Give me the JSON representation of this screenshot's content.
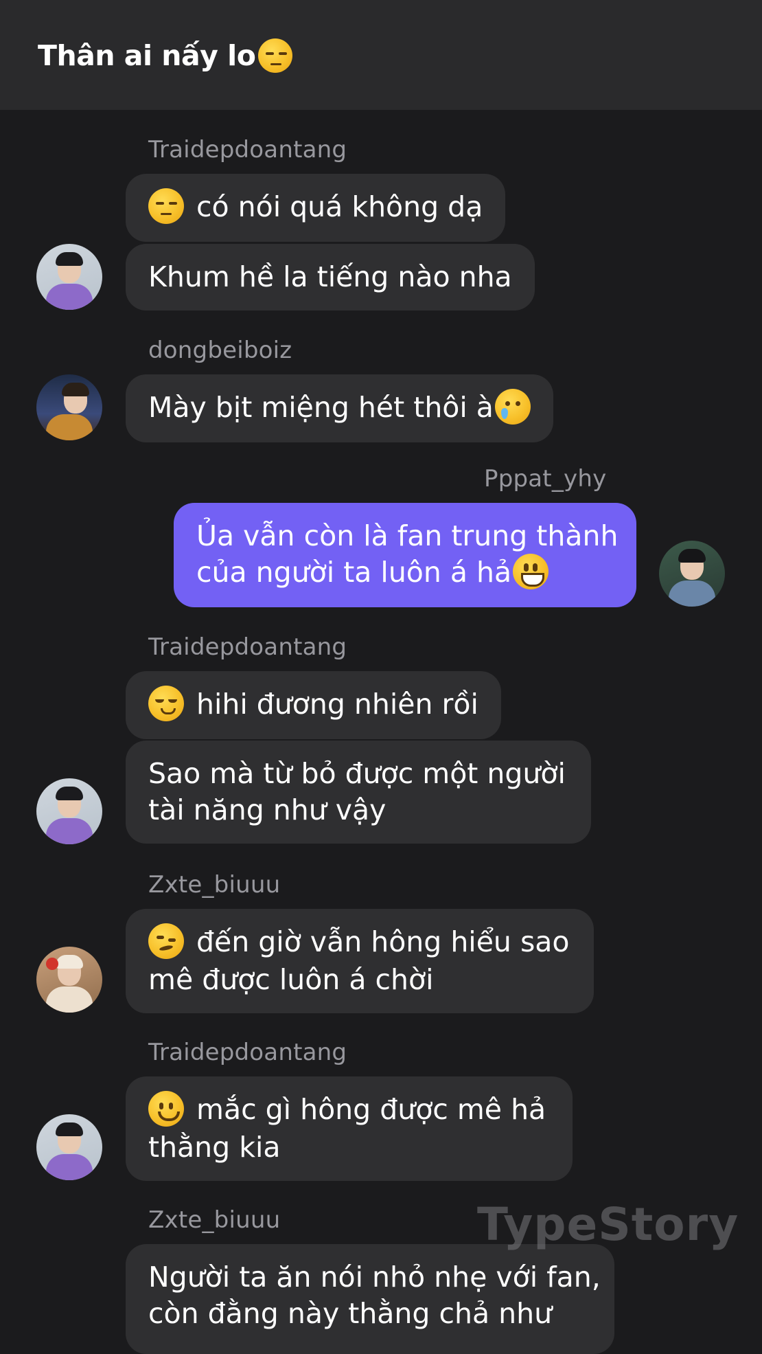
{
  "header": {
    "title": "Thân ai nấy lo",
    "title_emoji": "unamused-emoji-icon"
  },
  "messages": [
    {
      "sender": "Traidepdoantang",
      "bubbles": [
        {
          "emoji": "unamused",
          "text": "có nói quá không dạ"
        },
        {
          "text": "Khum hề la tiếng nào nha"
        }
      ]
    },
    {
      "sender": "dongbeiboiz",
      "bubbles": [
        {
          "text": "Mày bịt miệng hét thôi à",
          "trailing_emoji": "face-holding-back-tears"
        }
      ]
    },
    {
      "sender": "Pppat_yhy",
      "outgoing": true,
      "bubbles": [
        {
          "lines": [
            "Ủa vẫn còn là fan trung thành",
            "của người ta luôn á hả"
          ],
          "trailing_emoji": "grinning-face"
        }
      ]
    },
    {
      "sender": "Traidepdoantang",
      "bubbles": [
        {
          "emoji": "relieved",
          "text": "hihi đương nhiên rồi"
        },
        {
          "lines": [
            "Sao mà từ bỏ được một người",
            "tài năng như vậy"
          ]
        }
      ]
    },
    {
      "sender": "Zxte_biuuu",
      "bubbles": [
        {
          "emoji": "woozy",
          "lines": [
            "đến giờ vẫn hông hiểu sao",
            "mê được luôn á chời"
          ]
        }
      ]
    },
    {
      "sender": "Traidepdoantang",
      "bubbles": [
        {
          "emoji": "slightly-smiling",
          "lines": [
            "mắc gì hông được mê hả",
            "thằng kia"
          ]
        }
      ]
    },
    {
      "sender": "Zxte_biuuu",
      "bubbles": [
        {
          "lines": [
            "Người ta ăn nói nhỏ nhẹ với fan,",
            "còn đằng này thằng chả như"
          ]
        }
      ]
    }
  ],
  "watermark": "TypeStory",
  "colors": {
    "background": "#1b1b1d",
    "header": "#2a2a2c",
    "bubble": "#2f2f31",
    "outgoing_bubble": "#7361f4",
    "sender_name": "#98989e"
  }
}
